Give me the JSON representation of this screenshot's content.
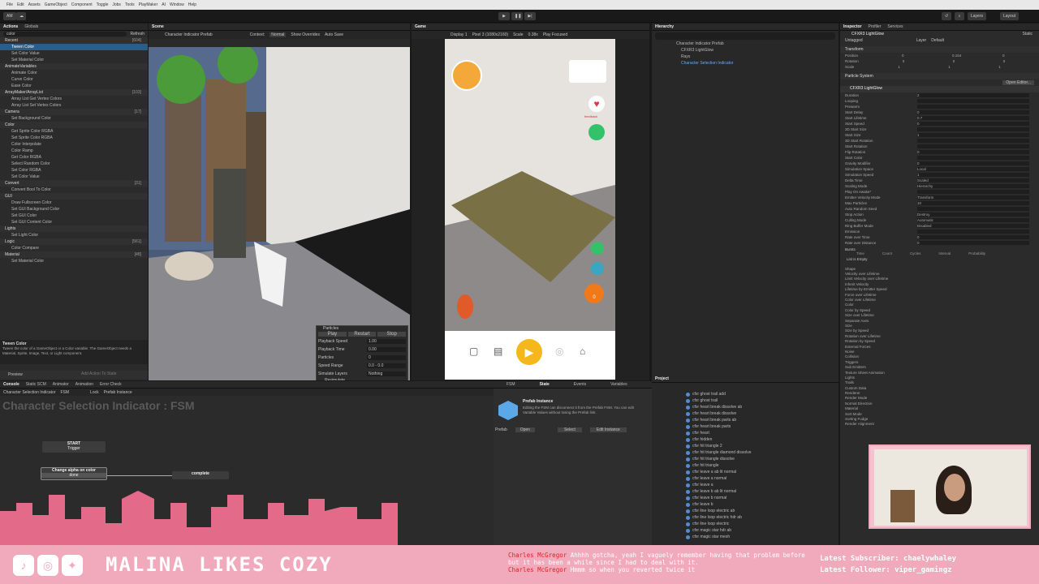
{
  "menubar": {
    "items": [
      "File",
      "Edit",
      "Assets",
      "GameObject",
      "Component",
      "Toggle",
      "Jobs",
      "Tools",
      "PlayMaker",
      "AI",
      "Window",
      "Help"
    ]
  },
  "toolbar": {
    "account": "AM",
    "layers": "Layers",
    "layout": "Layout"
  },
  "actions_panel": {
    "tabs": [
      "Actions",
      "Globals"
    ],
    "search_value": "color",
    "refresh": "Refresh",
    "groups": [
      {
        "name": "Recent",
        "count": "[604]",
        "items": [
          "Tween Color",
          "Set Color Value",
          "Set Material Color"
        ],
        "count2": "[5]"
      },
      {
        "name": "AnimateVariables",
        "count": "",
        "items": [
          "Animate Color",
          "Curve Color",
          "Ease Color"
        ]
      },
      {
        "name": "ArrayMaker/ArrayList",
        "count": "[103]",
        "items": [
          "Array List Get Vertex Colors",
          "Array List Set Vertex Colors"
        ]
      },
      {
        "name": "Camera",
        "count": "[17]",
        "items": [
          "Set Background Color"
        ]
      },
      {
        "name": "Color",
        "count": "",
        "items": [
          "Get Sprite Color RGBA",
          "Set Sprite Color RGBA",
          "Color Interpolate",
          "Color Ramp",
          "Get Color RGBA",
          "Select Random Color",
          "Set Color RGBA",
          "Set Color Value"
        ]
      },
      {
        "name": "Convert",
        "count": "[31]",
        "items": [
          "Convert Bool To Color"
        ]
      },
      {
        "name": "GUI",
        "count": "",
        "items": [
          "Draw Fullscreen Color",
          "Set GUI Background Color",
          "Set GUI Color",
          "Set GUI Content Color"
        ]
      },
      {
        "name": "Lights",
        "count": "",
        "items": [
          "Set Light Color"
        ]
      },
      {
        "name": "Logic",
        "count": "[561]",
        "items": [
          "Color Compare"
        ]
      },
      {
        "name": "Material",
        "count": "[48]",
        "items": [
          "Set Material Color"
        ]
      }
    ],
    "help_title": "Tween Color",
    "help_text": "Tween the color of a GameObject or a Color variable. The GameObject needs a Material, Sprite, Image, Text, or Light component.",
    "preview_label": "Preview",
    "add_action": "Add Action To State"
  },
  "scene": {
    "tabs": [
      "Scene",
      "Game"
    ],
    "prefab_title": "Character Indicator Prefab",
    "context_label": "Context:",
    "context_value": "Normal",
    "show_overrides": "Show Overrides",
    "auto_save": "Auto Save",
    "particles": {
      "header": "Particles",
      "play": "Play",
      "restart": "Restart",
      "stop": "Stop",
      "rows": [
        [
          "Playback Speed",
          "1.00"
        ],
        [
          "Playback Time",
          "0.00"
        ],
        [
          "Particles",
          "0"
        ],
        [
          "Speed Range",
          "0.0 - 0.0"
        ],
        [
          "Simulate Layers",
          "Nothing"
        ]
      ],
      "checks": [
        "Resimulate",
        "Show Bounds",
        "Show Only Selected"
      ]
    }
  },
  "game": {
    "display": "Display 1",
    "resolution": "Pixel 3 (1080x2160)",
    "scale_label": "Scale",
    "scale_value": "0.38x",
    "play_focused": "Play Focused",
    "heart_label": "feedback",
    "score": "0",
    "ui_colors": {
      "play": "#f5b81c",
      "heart": "#e8334a",
      "green": "#33c26a"
    }
  },
  "hierarchy": {
    "title": "Hierarchy",
    "items": [
      "Character Indicator Prefab",
      "CFXR3 LightGlow",
      "Rays",
      "Character Selection Indicator"
    ]
  },
  "project": {
    "title": "Project",
    "items": [
      "cfxr ghost trail add",
      "cfxr ghost trail",
      "cfxr heart break dissolve ab",
      "cfxr heart break dissolve",
      "cfxr heart break parts ab",
      "cfxr heart break parts",
      "cfxr heart",
      "cfxr hidden",
      "cfxr hit triangle 2",
      "cfxr hit triangle diamond dissolve",
      "cfxr hit triangle dissolve",
      "cfxr hit triangle",
      "cfxr leave a ab lit normal",
      "cfxr leave a normal",
      "cfxr leave a",
      "cfxr leave b ab lit normal",
      "cfxr leave b normal",
      "cfxr leave b",
      "cfxr line loop electric ab",
      "cfxr line loop electric hdr ab",
      "cfxr line loop electric",
      "cfxr magic star hdr ab",
      "cfxr magic star mesh"
    ]
  },
  "inspector": {
    "tabs": [
      "Inspector",
      "Profiler",
      "Services"
    ],
    "object_name": "CFXR3 LightGlow",
    "static": "Static",
    "tag": "Untagged",
    "layer_label": "Layer",
    "layer": "Default",
    "transform": "Transform",
    "position": {
      "label": "Position",
      "x": "0",
      "y": "0.154",
      "z": "0"
    },
    "rotation": {
      "label": "Rotation",
      "x": "0",
      "y": "0",
      "z": "0"
    },
    "scale": {
      "label": "Scale",
      "x": "1",
      "y": "1",
      "z": "1"
    },
    "particle_system": "Particle System",
    "open_editor": "Open Editor...",
    "ps_name": "CFXR3 LightGlow",
    "props": [
      [
        "Duration",
        "2"
      ],
      [
        "Looping",
        ""
      ],
      [
        "Prewarm",
        ""
      ],
      [
        "Start Delay",
        "0"
      ],
      [
        "Start Lifetime",
        "0.7"
      ],
      [
        "Start Speed",
        "0"
      ],
      [
        "3D Start Size",
        ""
      ],
      [
        "Start Size",
        "1"
      ],
      [
        "3D Start Rotation",
        ""
      ],
      [
        "Start Rotation",
        ""
      ],
      [
        "Flip Rotation",
        "0"
      ],
      [
        "Start Color",
        ""
      ],
      [
        "Gravity Modifier",
        "0"
      ],
      [
        "Simulation Space",
        "Local"
      ],
      [
        "Simulation Speed",
        "1"
      ],
      [
        "Delta Time",
        "Scaled"
      ],
      [
        "Scaling Mode",
        "Hierarchy"
      ],
      [
        "Play On Awake*",
        ""
      ],
      [
        "Emitter Velocity Mode",
        "Transform"
      ],
      [
        "Max Particles",
        "10"
      ],
      [
        "Auto Random Seed",
        ""
      ],
      [
        "Stop Action",
        "Destroy"
      ],
      [
        "Culling Mode",
        "Automatic"
      ],
      [
        "Ring Buffer Mode",
        "Disabled"
      ],
      [
        "Emission",
        ""
      ],
      [
        "Rate over Time",
        "0"
      ],
      [
        "Rate over Distance",
        "0"
      ]
    ],
    "bursts": "Bursts",
    "burst_cols": [
      "Time",
      "Count",
      "Cycles",
      "Interval",
      "Probability"
    ],
    "list_empty": "List is Empty",
    "modules": [
      "Shape",
      "Velocity over Lifetime",
      "Limit Velocity over Lifetime",
      "Inherit Velocity",
      "Lifetime by Emitter Speed",
      "Force over Lifetime",
      "Color over Lifetime",
      "Color",
      "Color by Speed",
      "Size over Lifetime",
      "Separate Axes",
      "Size",
      "Size by Speed",
      "Rotation over Lifetime",
      "Rotation by Speed",
      "External Forces",
      "Noise",
      "Collision",
      "Triggers",
      "Sub Emitters",
      "Texture Sheet Animation",
      "Lights",
      "Trails",
      "Custom Data",
      "Renderer",
      "Render Mode",
      "Normal Direction",
      "Material",
      "Sort Mode",
      "Sorting Fudge",
      "Render Alignment"
    ]
  },
  "fsm_panel": {
    "tabs": [
      "Console",
      "Static SCM",
      "Animator",
      "Animation",
      "Error Check"
    ],
    "breadcrumb": "Character Selection Indicator",
    "fsm_crumb": "FSM",
    "lock": "Lock",
    "prefab_instance": "Prefab Instance",
    "title": "Character Selection Indicator : FSM",
    "start_label": "START",
    "trigger_label": "Trigger",
    "state_label": "Change alpha on color",
    "done_label": "done",
    "complete_label": "complete"
  },
  "fsm_side": {
    "tabs": [
      "FSM",
      "State",
      "Events",
      "Variables"
    ],
    "heading": "Prefab Instance",
    "body": "Editing the FSM can disconnect it from the Prefab FSM. You can edit Variable Values without losing the Prefab link.",
    "prefab_label": "Prefab",
    "open": "Open",
    "select": "Select",
    "edit_instance": "Edit Instance"
  },
  "stream": {
    "brand": "MALINA LIKES COZY",
    "chat": [
      {
        "user": "Charles McGregor",
        "text": "Ahhhh gotcha, yeah I vaguely remember having that problem before but it has been a while since I had to deal with it."
      },
      {
        "user": "Charles McGregor",
        "text": "Hmmm so when you reverted twice it"
      }
    ],
    "subscriber_label": "Latest Subscriber:",
    "subscriber": "chaelywhaley",
    "follower_label": "Latest Follower:",
    "follower": "viper_gamingz",
    "colors": {
      "banner": "#f0aabb",
      "text": "#ffffff",
      "city": "#e46a8a"
    }
  }
}
